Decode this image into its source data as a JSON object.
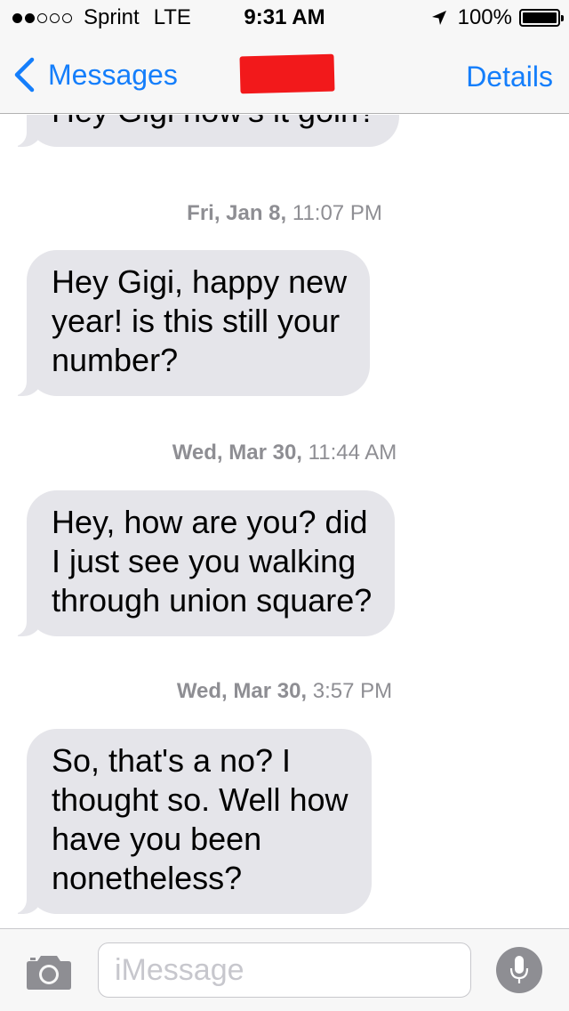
{
  "status_bar": {
    "signal": "●●○○○",
    "carrier": "Sprint",
    "network": "LTE",
    "time": "9:31 AM",
    "battery_percent": "100%",
    "battery_level": 1.0,
    "icons": [
      "signal-dots-icon",
      "location-arrow-icon",
      "battery-icon"
    ]
  },
  "nav": {
    "back_label": "Messages",
    "details_label": "Details",
    "contact_name_redacted": true,
    "redaction_color": "#f2191b",
    "accent_color": "#147efb"
  },
  "conversation": {
    "messages": [
      {
        "type": "received",
        "text": "Hey Gigi how's it goin?"
      },
      {
        "type": "timestamp",
        "day": "Fri, Jan 8,",
        "time": "11:07 PM"
      },
      {
        "type": "received",
        "text": "Hey Gigi, happy new\nyear! is this still your\nnumber?"
      },
      {
        "type": "timestamp",
        "day": "Wed, Mar 30,",
        "time": "11:44 AM"
      },
      {
        "type": "received",
        "text": "Hey, how are you? did\nI just see you walking\nthrough union square?"
      },
      {
        "type": "timestamp",
        "day": "Wed, Mar 30,",
        "time": "3:57 PM"
      },
      {
        "type": "received",
        "text": "So, that's a no? I\nthought so. Well how\nhave you been\nnonetheless?"
      }
    ],
    "bubble_color": "#e5e5ea"
  },
  "input_bar": {
    "placeholder": "iMessage",
    "value": "",
    "icons": [
      "camera-icon",
      "microphone-icon"
    ]
  }
}
